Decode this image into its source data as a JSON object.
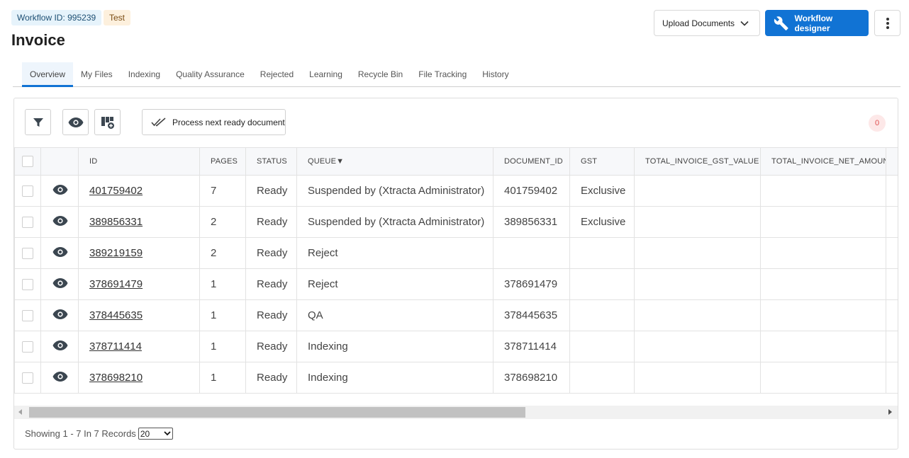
{
  "header": {
    "workflow_badge": "Workflow ID: 995239",
    "env_badge": "Test",
    "title": "Invoice",
    "upload_label": "Upload Documents",
    "designer_label": "Workflow designer"
  },
  "tabs": [
    {
      "label": "Overview",
      "active": true
    },
    {
      "label": "My Files"
    },
    {
      "label": "Indexing"
    },
    {
      "label": "Quality Assurance"
    },
    {
      "label": "Rejected"
    },
    {
      "label": "Learning"
    },
    {
      "label": "Recycle Bin"
    },
    {
      "label": "File Tracking"
    },
    {
      "label": "History"
    }
  ],
  "toolbar": {
    "process_label": "Process next ready document",
    "count": "0"
  },
  "table": {
    "columns": [
      "ID",
      "PAGES",
      "STATUS",
      "QUEUE▼",
      "DOCUMENT_ID",
      "GST",
      "TOTAL_INVOICE_GST_VALUE",
      "TOTAL_INVOICE_NET_AMOUNT"
    ],
    "rows": [
      [
        "401759402",
        "7",
        "Ready",
        "Suspended by (Xtracta Administrator)",
        "401759402",
        "Exclusive",
        "",
        ""
      ],
      [
        "389856331",
        "2",
        "Ready",
        "Suspended by (Xtracta Administrator)",
        "389856331",
        "Exclusive",
        "",
        ""
      ],
      [
        "389219159",
        "2",
        "Ready",
        "Reject",
        "",
        "",
        "",
        ""
      ],
      [
        "378691479",
        "1",
        "Ready",
        "Reject",
        "378691479",
        "",
        "",
        ""
      ],
      [
        "378445635",
        "1",
        "Ready",
        "QA",
        "378445635",
        "",
        "",
        ""
      ],
      [
        "378711414",
        "1",
        "Ready",
        "Indexing",
        "378711414",
        "",
        "",
        ""
      ],
      [
        "378698210",
        "1",
        "Ready",
        "Indexing",
        "378698210",
        "",
        "",
        ""
      ]
    ]
  },
  "footer": {
    "showing_text": "Showing 1 - 7 In 7 Records",
    "page_size": "20"
  },
  "icons": {
    "filter": "filter-icon",
    "view": "eye-icon",
    "columns": "columns-add-icon",
    "process": "double-check-icon",
    "designer": "wrench-icon",
    "more": "kebab-icon"
  },
  "colors": {
    "primary": "#1173d4",
    "badge_count": "#e05050"
  }
}
